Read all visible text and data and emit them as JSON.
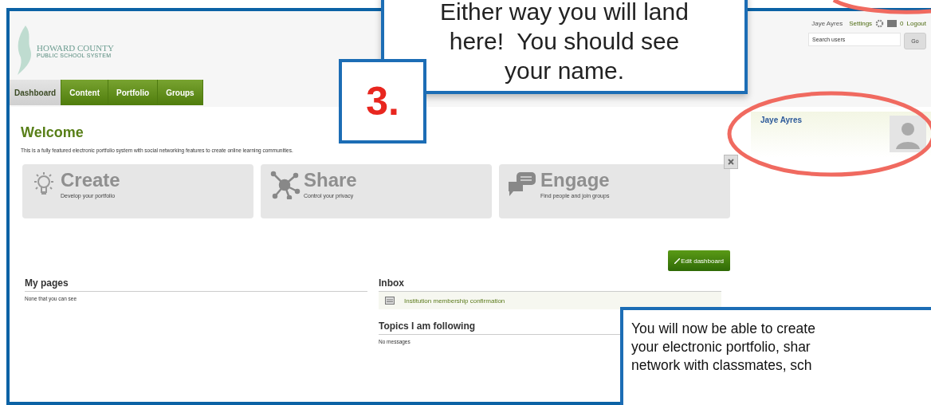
{
  "header": {
    "logo_line1": "HOWARD COUNTY",
    "logo_line2": "PUBLIC SCHOOL SYSTEM"
  },
  "top_nav": {
    "user": "Jaye Ayres",
    "settings": "Settings",
    "inbox_count": "0",
    "logout": "Logout"
  },
  "search": {
    "placeholder": "Search users",
    "button": "Go"
  },
  "tabs": [
    {
      "label": "Dashboard",
      "selected": true
    },
    {
      "label": "Content",
      "selected": false
    },
    {
      "label": "Portfolio",
      "selected": false
    },
    {
      "label": "Groups",
      "selected": false
    }
  ],
  "welcome": {
    "title": "Welcome",
    "description": "This is a fully featured electronic portfolio system with social networking features to create online learning communities."
  },
  "cards": [
    {
      "kind": "bulb",
      "title": "Create",
      "subtitle": "Develop your portfolio"
    },
    {
      "kind": "network",
      "title": "Share",
      "subtitle": "Control your privacy"
    },
    {
      "kind": "chat",
      "title": "Engage",
      "subtitle": "Find people and join groups"
    }
  ],
  "edit_button": "Edit dashboard",
  "my_pages": {
    "title": "My pages",
    "empty": "None that you can see"
  },
  "inbox": {
    "title": "Inbox",
    "items": [
      "Institution membership confirmation"
    ]
  },
  "topics": {
    "title": "Topics I am following",
    "empty": "No messages"
  },
  "profile": {
    "name": "Jaye Ayres"
  },
  "callouts": [
    {
      "kind": "top",
      "text": "Either way you will land\nhere!  You should see\nyour name."
    },
    {
      "kind": "bottom",
      "text": "You will now be able to create\nyour electronic portfolio, shar\nnetwork with classmates, sch"
    }
  ],
  "step_badge": "3."
}
